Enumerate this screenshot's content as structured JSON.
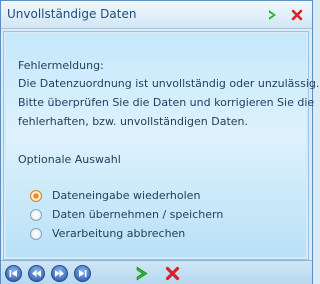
{
  "window": {
    "title": "Unvollständige Daten"
  },
  "message": {
    "heading": "Fehlermeldung:",
    "line1": "Die Datenzuordnung ist unvollständig oder unzulässig.",
    "line2": "Bitte überprüfen Sie die Daten und korrigieren Sie die",
    "line3": "fehlerhaften, bzw. unvollständigen Daten."
  },
  "options": {
    "heading": "Optionale Auswahl",
    "items": [
      {
        "label": "Dateneingabe wiederholen",
        "selected": true
      },
      {
        "label": "Daten übernehmen / speichern",
        "selected": false
      },
      {
        "label": "Verarbeitung abbrechen",
        "selected": false
      }
    ]
  },
  "icons": {
    "confirm": "arrow-right-icon",
    "cancel": "close-icon",
    "nav": [
      "first-record-icon",
      "previous-record-icon",
      "next-record-icon",
      "last-record-icon"
    ]
  },
  "colors": {
    "confirm_green": "#2bb52b",
    "cancel_red": "#e02020",
    "accent_orange": "#f08a1c"
  }
}
